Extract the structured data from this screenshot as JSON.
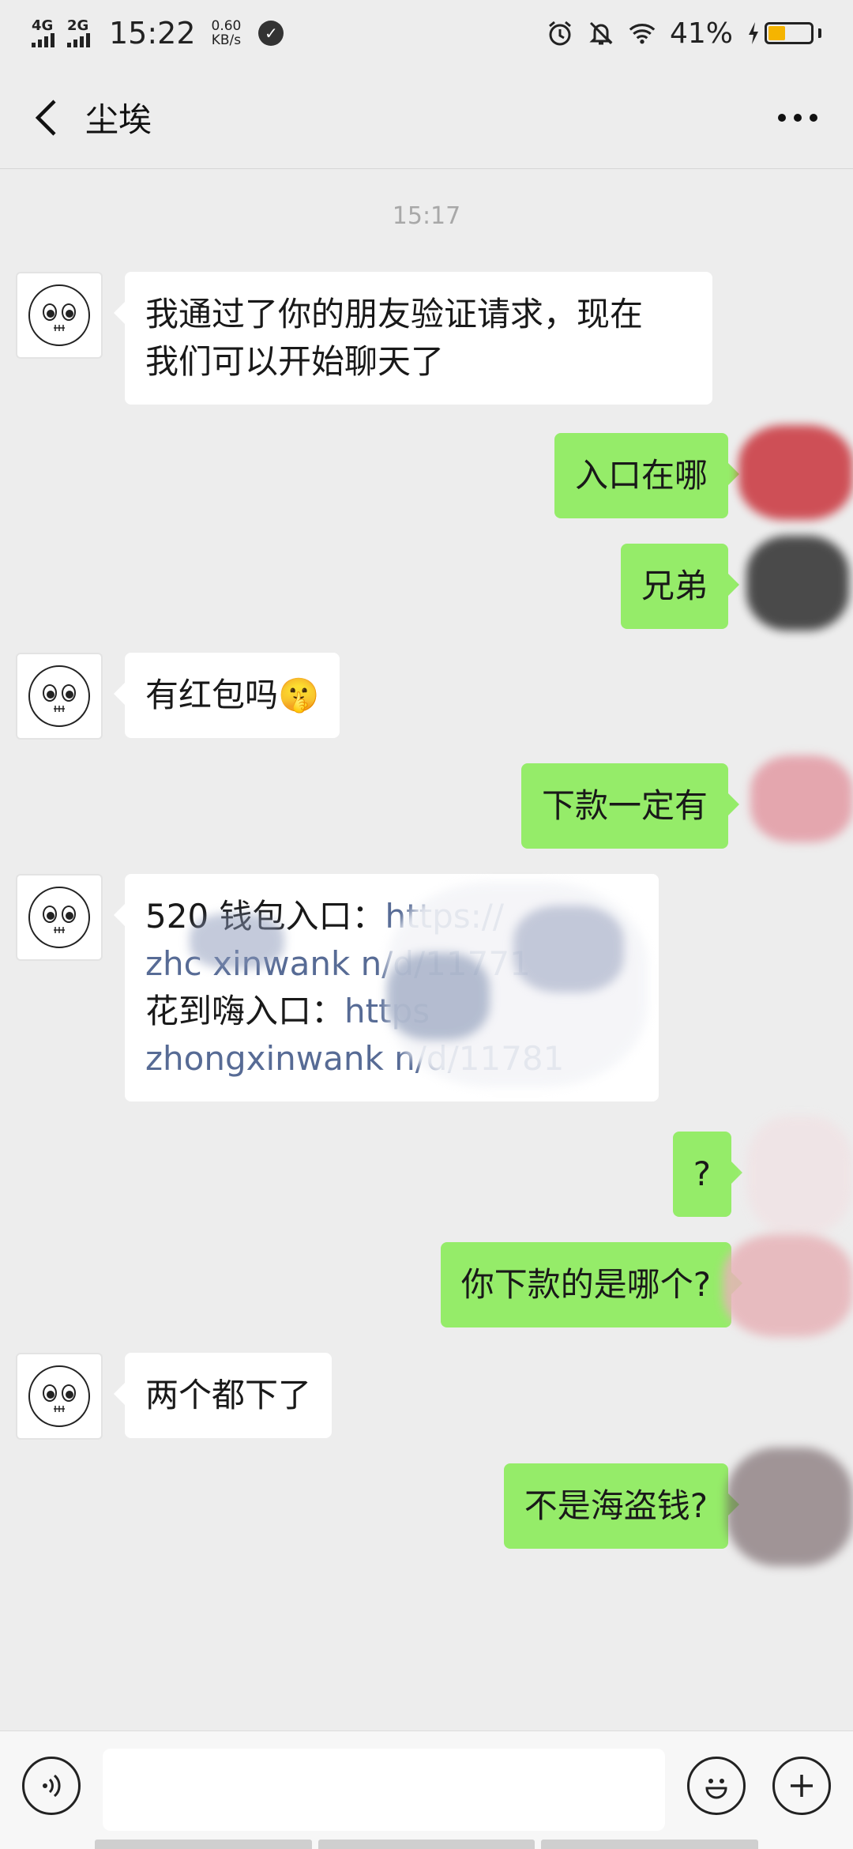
{
  "status_bar": {
    "network1": "4G",
    "network2": "2G",
    "time": "15:22",
    "speed_value": "0.60",
    "speed_unit": "KB/s",
    "battery_percent": "41%",
    "battery_level": 0.41,
    "icons": [
      "alarm-icon",
      "mute-icon",
      "wifi-icon",
      "charging-icon",
      "battery-icon"
    ]
  },
  "header": {
    "title": "尘埃",
    "back_icon": "chevron-left-icon",
    "more_icon": "more-dots-icon"
  },
  "conversation": {
    "timestamp": "15:17",
    "messages": [
      {
        "side": "in",
        "text_line1": "我通过了你的朋友验证请求，现在",
        "text_line2": "我们可以开始聊天了"
      },
      {
        "side": "out",
        "text": "入口在哪"
      },
      {
        "side": "out",
        "text": "兄弟"
      },
      {
        "side": "in",
        "text": "有红包吗",
        "emoji": "🤫"
      },
      {
        "side": "out",
        "text": "下款一定有"
      },
      {
        "side": "in",
        "line1_prefix": "520 钱包入口：",
        "line1_link": "https://",
        "line2_link": "zhc   xinwank          n/d/11771",
        "line3_prefix": "花到嗨入口：",
        "line3_link": "https",
        "line4_link": "zhongxinwank       n/d/11781"
      },
      {
        "side": "out",
        "text": "?"
      },
      {
        "side": "out",
        "text": "你下款的是哪个?"
      },
      {
        "side": "in",
        "text": "两个都下了"
      },
      {
        "side": "out",
        "text": "不是海盗钱?"
      }
    ]
  },
  "input_bar": {
    "voice_icon": "voice-icon",
    "emoji_icon": "emoji-icon",
    "plus_icon": "plus-icon",
    "input_value": ""
  },
  "colors": {
    "background": "#ededed",
    "outgoing_bubble": "#95ec69",
    "incoming_bubble": "#ffffff",
    "link": "#576b95"
  }
}
